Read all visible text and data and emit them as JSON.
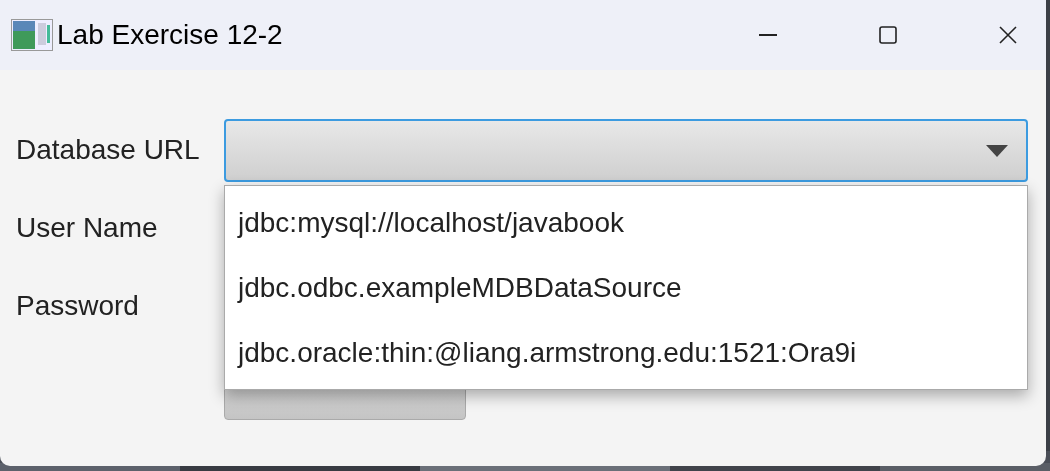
{
  "window": {
    "title": "Lab Exercise 12-2"
  },
  "form": {
    "labels": [
      "Database URL",
      "User Name",
      "Password"
    ],
    "url_combo": {
      "expanded": true,
      "options": [
        {
          "label": "jdbc:mysql://localhost/javabook",
          "selected": false
        },
        {
          "label": "jdbc.odbc.exampleMDBDataSource",
          "selected": false
        },
        {
          "label": "jdbc.oracle:thin:@liang.armstrong.edu:1521:Ora9i",
          "selected": false
        }
      ]
    }
  }
}
